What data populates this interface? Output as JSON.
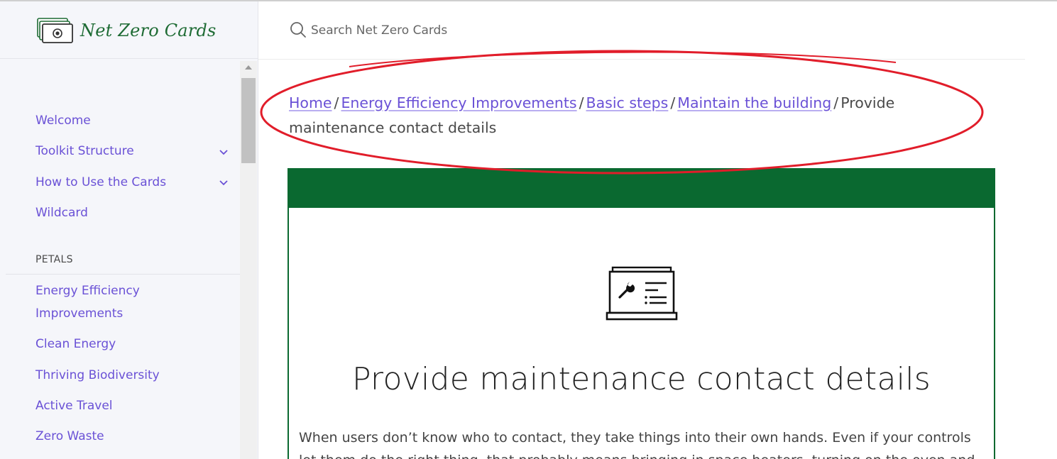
{
  "brand": {
    "title": "Net Zero Cards",
    "accent": "#1e6b34"
  },
  "search": {
    "placeholder": "Search Net Zero Cards"
  },
  "sidebar": {
    "items": [
      {
        "label": "Welcome"
      },
      {
        "label": "Toolkit Structure",
        "expandable": true
      },
      {
        "label": "How to Use the Cards",
        "expandable": true
      },
      {
        "label": "Wildcard"
      }
    ],
    "section_label": "PETALS",
    "petals": [
      {
        "label": "Energy Efficiency Improvements"
      },
      {
        "label": "Clean Energy"
      },
      {
        "label": "Thriving Biodiversity"
      },
      {
        "label": "Active Travel"
      },
      {
        "label": "Zero Waste"
      }
    ]
  },
  "breadcrumb": {
    "links": [
      "Home",
      "Energy Efficiency Improvements",
      "Basic steps",
      "Maintain the building"
    ],
    "separator": "/",
    "current": "Provide maintenance contact details"
  },
  "card": {
    "header_color": "#0a6930",
    "icon": "maintenance-panel-icon",
    "title": "Provide maintenance contact details",
    "body": "When users don’t know who to contact, they take things into their own hands. Even if your controls let them do the right thing, that probably means bringing in space heaters, turning on the oven and"
  },
  "colors": {
    "link": "#6a51d6",
    "annotation": "#e11d2a"
  }
}
